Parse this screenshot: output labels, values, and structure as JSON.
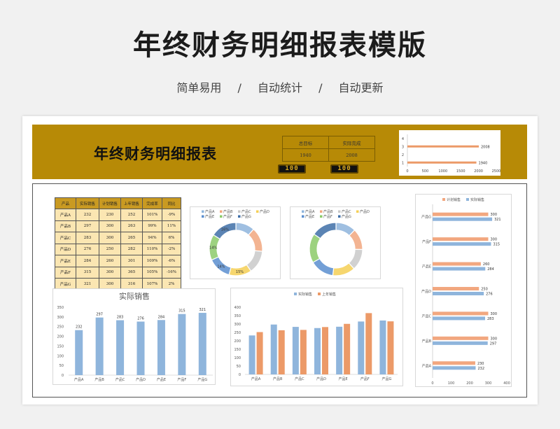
{
  "page": {
    "title": "年终财务明细报表模版",
    "subtitle": "简单易用　 /　 自动统计　 /　 自动更新"
  },
  "banner": {
    "title": "年终财务明细报表",
    "kpi_headers": [
      "总目标",
      "实际完成"
    ],
    "kpi_values": [
      "1940",
      "2008"
    ],
    "counters": [
      "100",
      "100"
    ]
  },
  "colors": {
    "gold": "#b78a06",
    "table_header": "#c99a22",
    "table_cell": "#fbe6b2",
    "blue": "#8fb5dc",
    "orange": "#ec9a68",
    "plan_orange": "#f2a77f"
  },
  "table": {
    "headers": [
      "产品",
      "实际销售",
      "计划销售",
      "上年销售",
      "完成率",
      "同比"
    ],
    "rows": [
      [
        "产品A",
        "232",
        "230",
        "252",
        "101%",
        "-9%"
      ],
      [
        "产品B",
        "297",
        "300",
        "263",
        "99%",
        "11%"
      ],
      [
        "产品C",
        "283",
        "300",
        "265",
        "94%",
        "6%"
      ],
      [
        "产品D",
        "276",
        "250",
        "282",
        "110%",
        "-2%"
      ],
      [
        "产品E",
        "284",
        "260",
        "301",
        "109%",
        "-6%"
      ],
      [
        "产品F",
        "315",
        "300",
        "365",
        "105%",
        "-16%"
      ],
      [
        "产品G",
        "321",
        "300",
        "316",
        "107%",
        "2%"
      ]
    ]
  },
  "chart_data": [
    {
      "type": "bar",
      "orientation": "horizontal",
      "categories": [
        "1"
      ],
      "series": [
        {
          "values": [
            1940
          ]
        },
        {
          "values": [
            2008
          ]
        }
      ],
      "xlim": [
        0,
        2500
      ],
      "xticks": [
        "0",
        "500",
        "1000",
        "1500",
        "2000",
        "2500"
      ],
      "yticks": [
        "1",
        "2",
        "3",
        "4"
      ]
    },
    {
      "type": "pie",
      "style": "donut",
      "legend_labels": [
        "产品A",
        "产品B",
        "产品C",
        "产品D",
        "产品E",
        "产品F",
        "产品G"
      ],
      "values": [
        232,
        297,
        283,
        276,
        284,
        315,
        321
      ],
      "slice_labels": [
        "",
        "",
        "",
        "15%",
        "14%",
        "14%",
        "16%"
      ]
    },
    {
      "type": "pie",
      "style": "donut",
      "legend_labels": [
        "产品A",
        "产品B",
        "产品C",
        "产品D",
        "产品E",
        "产品F",
        "产品G"
      ],
      "values": [
        252,
        263,
        265,
        282,
        301,
        365,
        316
      ],
      "slice_labels": [
        "",
        "",
        "",
        "",
        "",
        "",
        ""
      ]
    },
    {
      "type": "bar",
      "title": "实际销售",
      "categories": [
        "产品A",
        "产品B",
        "产品C",
        "产品D",
        "产品E",
        "产品F",
        "产品G"
      ],
      "values": [
        232,
        297,
        283,
        276,
        284,
        315,
        321
      ],
      "ylim": [
        0,
        350
      ],
      "yticks": [
        "0",
        "50",
        "100",
        "150",
        "200",
        "250",
        "300",
        "350"
      ]
    },
    {
      "type": "bar",
      "legend": "top",
      "categories": [
        "产品A",
        "产品B",
        "产品C",
        "产品D",
        "产品E",
        "产品F",
        "产品G"
      ],
      "series": [
        {
          "name": "实际销售",
          "values": [
            232,
            297,
            283,
            276,
            284,
            315,
            321
          ]
        },
        {
          "name": "上年销售",
          "values": [
            252,
            263,
            265,
            282,
            301,
            365,
            316
          ]
        }
      ],
      "ylim": [
        0,
        400
      ],
      "yticks": [
        "0",
        "50",
        "100",
        "150",
        "200",
        "250",
        "300",
        "350",
        "400"
      ]
    },
    {
      "type": "bar",
      "orientation": "horizontal",
      "legend": "top",
      "categories": [
        "产品G",
        "产品F",
        "产品E",
        "产品D",
        "产品C",
        "产品B",
        "产品A"
      ],
      "series": [
        {
          "name": "计划销售",
          "values": [
            300,
            300,
            260,
            250,
            300,
            300,
            230
          ]
        },
        {
          "name": "实际销售",
          "values": [
            321,
            315,
            284,
            276,
            283,
            297,
            232
          ]
        }
      ],
      "xlim": [
        0,
        400
      ],
      "xticks": [
        "0",
        "100",
        "200",
        "300",
        "400"
      ]
    }
  ]
}
